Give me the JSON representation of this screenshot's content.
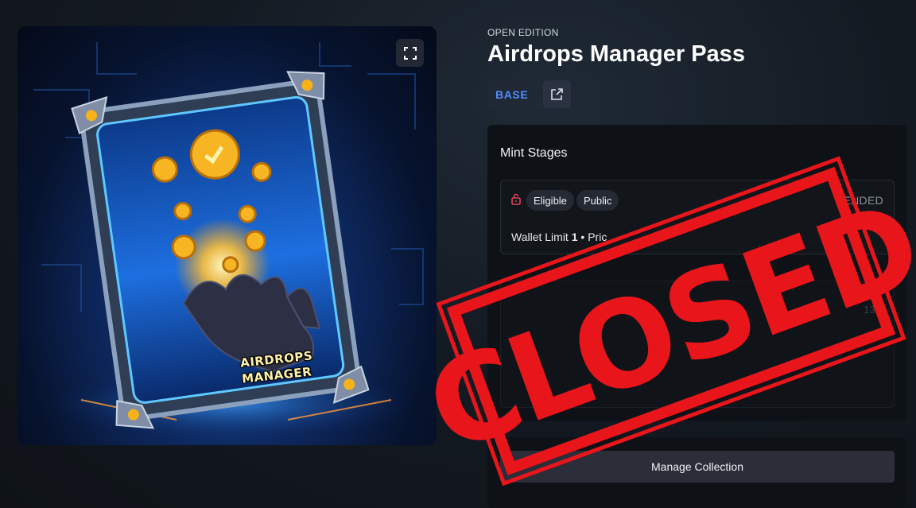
{
  "collection": {
    "edition_type": "OPEN EDITION",
    "name": "Airdrops Manager Pass",
    "chain": "BASE",
    "artwork_label_line1": "AIRDROPS",
    "artwork_label_line2": "MANAGER"
  },
  "mint_stages": {
    "title": "Mint Stages",
    "stage": {
      "tags": [
        "Eligible",
        "Public"
      ],
      "status": "ENDED",
      "wallet_limit_label": "Wallet Limit",
      "wallet_limit_value": "1",
      "separator": "•",
      "price_partial": "Pric"
    },
    "second_stage_partial": "131"
  },
  "actions": {
    "manage_label": "Manage Collection"
  },
  "overlay": {
    "stamp_text": "CLOSED",
    "stamp_color": "#e8151b"
  },
  "icons": {
    "expand": "expand-icon",
    "external_link": "external-link-icon",
    "lock": "lock-icon"
  },
  "colors": {
    "background": "#141a22",
    "card": "#0e1116",
    "chain_accent": "#4f8dff",
    "lock_accent": "#e0445e"
  }
}
